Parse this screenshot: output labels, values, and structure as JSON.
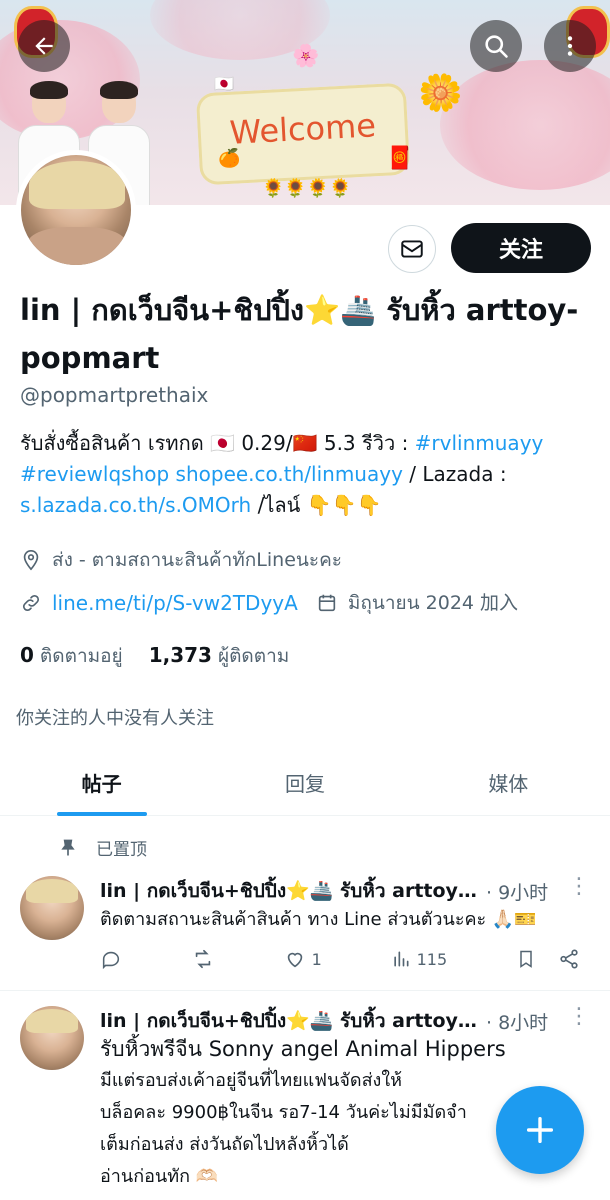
{
  "banner": {
    "welcome_text": "Welcome"
  },
  "profile": {
    "display_name": "lin | กดเว็บจีน+ชิปปิ้ง⭐🚢 รับหิ้ว arttoy-popmart",
    "handle": "@popmartprethaix",
    "follow_label": "关注",
    "bio_line1_prefix": "รับสั่งซื้อสินค้า เรทกด 🇯🇵 0.29/🇨🇳 5.3 รีวิว : ",
    "bio_link1": "#rvlinmuayy",
    "bio_link2": "#reviewlqshop",
    "bio_link3": "shopee.co.th/linmuayy",
    "bio_mid": " / Lazada :",
    "bio_link4": "s.lazada.co.th/s.OMOrh",
    "bio_end": " /ไลน์ 👇👇👇",
    "location": "ส่ง - ตามสถานะสินค้าทักLineนะคะ",
    "website": "line.me/ti/p/S-vw2TDyyA",
    "joined": "มิถุนายน 2024 加入",
    "following_count": "0",
    "following_label": "ติดตามอยู่",
    "followers_count": "1,373",
    "followers_label": "ผู้ติดตาม",
    "no_mutual": "你关注的人中没有人关注"
  },
  "tabs": [
    {
      "label": "帖子"
    },
    {
      "label": "回复"
    },
    {
      "label": "媒体"
    }
  ],
  "pinned_label": "已置顶",
  "tweets": [
    {
      "name": "lin | กดเว็บจีน+ชิปปิ้ง⭐🚢 รับหิ้ว arttoy-popmart",
      "time": "· 9小时",
      "text": "ติดตามสถานะสินค้าสินค้า ทาง Line ส่วนตัวนะคะ 🙏🏻🎫",
      "replies": "",
      "retweets": "",
      "likes": "1",
      "views": "115"
    },
    {
      "name": "lin | กดเว็บจีน+ชิปปิ้ง⭐🚢 รับหิ้ว arttoy-popmart",
      "time": "· 8小时",
      "line1": "รับหิ้วพรีจีน Sonny angel  Animal Hippers",
      "line2": "มีแต่รอบส่งเค้าอยู่จีนที่ไทยแฟนจัดส่งให้",
      "line3": "บล็อคละ 9900฿ในจีน รอ7-14 วันค่ะไม่มีมัดจำ",
      "line4": "เต็มก่อนส่ง  ส่งวันถัดไปหลังหิ้วได้",
      "line5": "อ่านก่อนทัก 🫶🏻"
    }
  ]
}
